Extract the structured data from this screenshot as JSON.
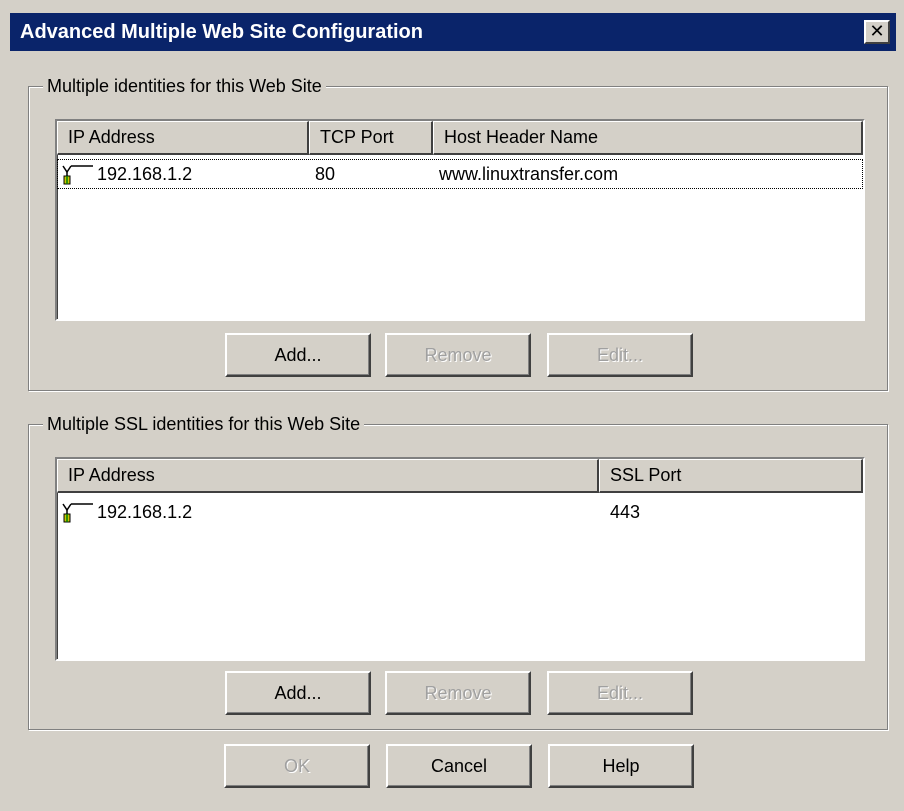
{
  "window": {
    "title": "Advanced Multiple Web Site Configuration",
    "close_glyph": "✕"
  },
  "identities": {
    "label": "Multiple identities for this Web Site",
    "columns": [
      "IP Address",
      "TCP Port",
      "Host Header Name"
    ],
    "rows": [
      {
        "ip": "192.168.1.2",
        "port": "80",
        "host": "www.linuxtransfer.com"
      }
    ],
    "buttons": {
      "add": "Add...",
      "remove": "Remove",
      "edit": "Edit..."
    }
  },
  "ssl": {
    "label": "Multiple SSL identities for this Web Site",
    "columns": [
      "IP Address",
      "SSL Port"
    ],
    "rows": [
      {
        "ip": "192.168.1.2",
        "port": "443"
      }
    ],
    "buttons": {
      "add": "Add...",
      "remove": "Remove",
      "edit": "Edit..."
    }
  },
  "footer": {
    "ok": "OK",
    "cancel": "Cancel",
    "help": "Help"
  },
  "icons": {
    "row_icon": "network-plug-icon"
  },
  "colors": {
    "titlebar": "#0a246a",
    "face": "#d4d0c8"
  }
}
